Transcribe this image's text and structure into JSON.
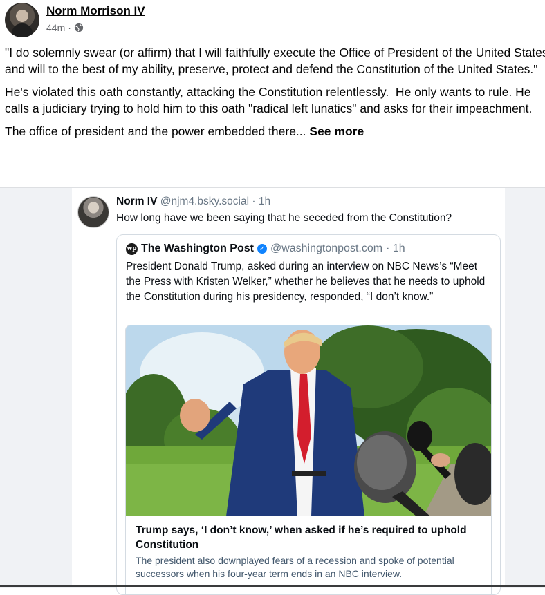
{
  "post": {
    "author": "Norm Morrison IV",
    "time": "44m",
    "separator": "·",
    "paragraphs": [
      "\"I do solemnly swear (or affirm) that I will faithfully execute the Office of President of the United States, and will to the best of my ability, preserve, protect and defend the Constitution of the United States.\"",
      "He's violated this oath constantly, attacking the Constitution relentlessly.  He only wants to rule. He calls a judiciary trying to hold him to this oath \"radical left lunatics\" and asks for their impeachment."
    ],
    "truncated_text": "The office of president and the power embedded there...",
    "see_more": "See more"
  },
  "bsky": {
    "name": "Norm IV",
    "handle": "@njm4.bsky.social",
    "time": "· 1h",
    "text": "How long have we been saying that he seceded from the Constitution?",
    "quote": {
      "logo_text": "wp",
      "name": "The Washington Post",
      "handle": "@washingtonpost.com",
      "time": "· 1h",
      "text": "President Donald Trump, asked during an interview on NBC News’s “Meet the Press with Kristen Welker,” whether he believes that he needs to uphold the Constitution during his presidency, responded, “I don’t know.”",
      "link_title": "Trump says, ‘I don’t know,’ when asked if he’s required to uphold Constitution",
      "link_description": "The president also downplayed fears of a recession and spoke of potential successors when his four-year term ends in an NBC interview."
    }
  },
  "icons": {
    "privacy": "globe-icon",
    "verified": "verified-badge-icon"
  },
  "colors": {
    "link_blue": "#1083fe",
    "muted": "#65676b",
    "embed_bg": "#f0f2f5"
  }
}
